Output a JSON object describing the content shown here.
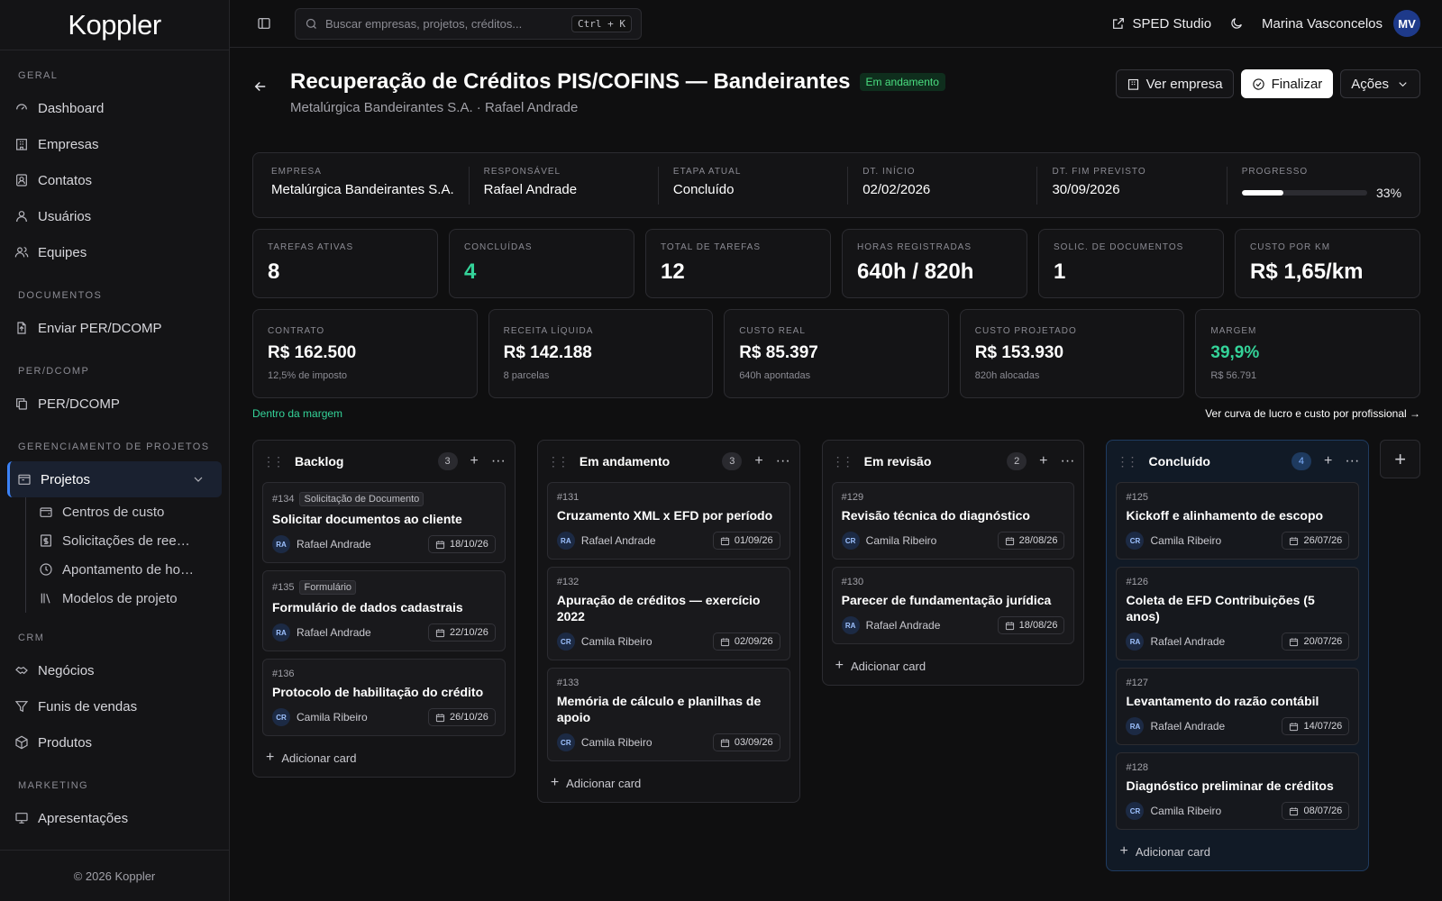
{
  "app": {
    "logo": "Koppler",
    "footer": "© 2026 Koppler"
  },
  "sidebar": {
    "sections": [
      {
        "title": "GERAL",
        "items": [
          {
            "label": "Dashboard",
            "icon": "dashboard-icon"
          },
          {
            "label": "Empresas",
            "icon": "building-icon"
          },
          {
            "label": "Contatos",
            "icon": "contact-icon"
          },
          {
            "label": "Usuários",
            "icon": "user-icon"
          },
          {
            "label": "Equipes",
            "icon": "team-icon"
          }
        ]
      },
      {
        "title": "DOCUMENTOS",
        "items": [
          {
            "label": "Enviar PER/DCOMP",
            "icon": "file-upload-icon"
          }
        ]
      },
      {
        "title": "PER/DCOMP",
        "items": [
          {
            "label": "PER/DCOMP",
            "icon": "copy-icon"
          }
        ]
      },
      {
        "title": "GERENCIAMENTO DE PROJETOS",
        "active": "Projetos",
        "sub": [
          {
            "label": "Centros de custo"
          },
          {
            "label": "Solicitações de reembolso"
          },
          {
            "label": "Apontamento de horas"
          },
          {
            "label": "Modelos de projeto"
          }
        ]
      },
      {
        "title": "CRM",
        "items": [
          {
            "label": "Negócios",
            "icon": "handshake-icon"
          },
          {
            "label": "Funis de vendas",
            "icon": "filter-icon"
          },
          {
            "label": "Produtos",
            "icon": "package-icon"
          }
        ]
      },
      {
        "title": "MARKETING",
        "items": [
          {
            "label": "Apresentações",
            "icon": "presentation-icon"
          }
        ]
      }
    ]
  },
  "topbar": {
    "search_placeholder": "Buscar empresas, projetos, créditos...",
    "shortcut": "Ctrl + K",
    "sped": "SPED Studio",
    "user": "Marina Vasconcelos",
    "initials": "MV"
  },
  "project": {
    "title": "Recuperação de Créditos PIS/COFINS — Bandeirantes",
    "status": "Em andamento",
    "subtitle": "Metalúrgica Bandeirantes S.A. · Rafael Andrade",
    "actions": {
      "view": "Ver empresa",
      "finish": "Finalizar",
      "more": "Ações"
    }
  },
  "info": [
    {
      "label": "EMPRESA",
      "value": "Metalúrgica Bandeirantes S.A."
    },
    {
      "label": "RESPONSÁVEL",
      "value": "Rafael Andrade"
    },
    {
      "label": "ETAPA ATUAL",
      "value": "Concluído"
    },
    {
      "label": "DT. INÍCIO",
      "value": "02/02/2026"
    },
    {
      "label": "DT. FIM PREVISTO",
      "value": "30/09/2026"
    }
  ],
  "progress": {
    "label": "PROGRESSO",
    "value": "33%",
    "fraction": 0.33
  },
  "stats": [
    {
      "label": "TAREFAS ATIVAS",
      "value": "8"
    },
    {
      "label": "CONCLUÍDAS",
      "value": "4"
    },
    {
      "label": "TOTAL DE TAREFAS",
      "value": "12"
    },
    {
      "label": "HORAS REGISTRADAS",
      "value": "640h / 820h"
    },
    {
      "label": "SOLIC. DE DOCUMENTOS",
      "value": "1"
    },
    {
      "label": "CUSTO POR KM",
      "value": "R$ 1,65/km"
    }
  ],
  "finance": [
    {
      "label": "CONTRATO",
      "value": "R$ 162.500",
      "note": "12,5% de imposto"
    },
    {
      "label": "RECEITA LÍQUIDA",
      "value": "R$ 142.188",
      "note": "8 parcelas"
    },
    {
      "label": "CUSTO REAL",
      "value": "R$ 85.397",
      "note": "640h apontadas"
    },
    {
      "label": "CUSTO PROJETADO",
      "value": "R$ 153.930",
      "note": "820h alocadas"
    },
    {
      "label": "MARGEM",
      "value": "39,9%",
      "note": "R$ 56.791"
    }
  ],
  "margin": {
    "status": "Dentro da margem",
    "link": "Ver curva de lucro e custo por profissional →"
  },
  "board": {
    "add_card": "Adicionar card",
    "columns": [
      {
        "title": "Backlog",
        "count": "3",
        "cards": [
          {
            "num": "#134",
            "tag": "Solicitação de Documento",
            "title": "Solicitar documentos ao cliente",
            "initials": "RA",
            "owner": "Rafael Andrade",
            "date": "18/10/26"
          },
          {
            "num": "#135",
            "tag": "Formulário",
            "title": "Formulário de dados cadastrais",
            "initials": "RA",
            "owner": "Rafael Andrade",
            "date": "22/10/26"
          },
          {
            "num": "#136",
            "tag": "",
            "title": "Protocolo de habilitação do crédito",
            "initials": "CR",
            "owner": "Camila Ribeiro",
            "date": "26/10/26"
          }
        ]
      },
      {
        "title": "Em andamento",
        "count": "3",
        "cards": [
          {
            "num": "#131",
            "tag": "",
            "title": "Cruzamento XML x EFD por período",
            "initials": "RA",
            "owner": "Rafael Andrade",
            "date": "01/09/26"
          },
          {
            "num": "#132",
            "tag": "",
            "title": "Apuração de créditos — exercício 2022",
            "initials": "CR",
            "owner": "Camila Ribeiro",
            "date": "02/09/26"
          },
          {
            "num": "#133",
            "tag": "",
            "title": "Memória de cálculo e planilhas de apoio",
            "initials": "CR",
            "owner": "Camila Ribeiro",
            "date": "03/09/26"
          }
        ]
      },
      {
        "title": "Em revisão",
        "count": "2",
        "cards": [
          {
            "num": "#129",
            "tag": "",
            "title": "Revisão técnica do diagnóstico",
            "initials": "CR",
            "owner": "Camila Ribeiro",
            "date": "28/08/26"
          },
          {
            "num": "#130",
            "tag": "",
            "title": "Parecer de fundamentação jurídica",
            "initials": "RA",
            "owner": "Rafael Andrade",
            "date": "18/08/26"
          }
        ]
      },
      {
        "title": "Concluído",
        "count": "4",
        "cards": [
          {
            "num": "#125",
            "tag": "",
            "title": "Kickoff e alinhamento de escopo",
            "initials": "CR",
            "owner": "Camila Ribeiro",
            "date": "26/07/26"
          },
          {
            "num": "#126",
            "tag": "",
            "title": "Coleta de EFD Contribuições (5 anos)",
            "initials": "RA",
            "owner": "Rafael Andrade",
            "date": "20/07/26"
          },
          {
            "num": "#127",
            "tag": "",
            "title": "Levantamento do razão contábil",
            "initials": "RA",
            "owner": "Rafael Andrade",
            "date": "14/07/26"
          },
          {
            "num": "#128",
            "tag": "",
            "title": "Diagnóstico preliminar de créditos",
            "initials": "CR",
            "owner": "Camila Ribeiro",
            "date": "08/07/26"
          }
        ]
      }
    ]
  }
}
